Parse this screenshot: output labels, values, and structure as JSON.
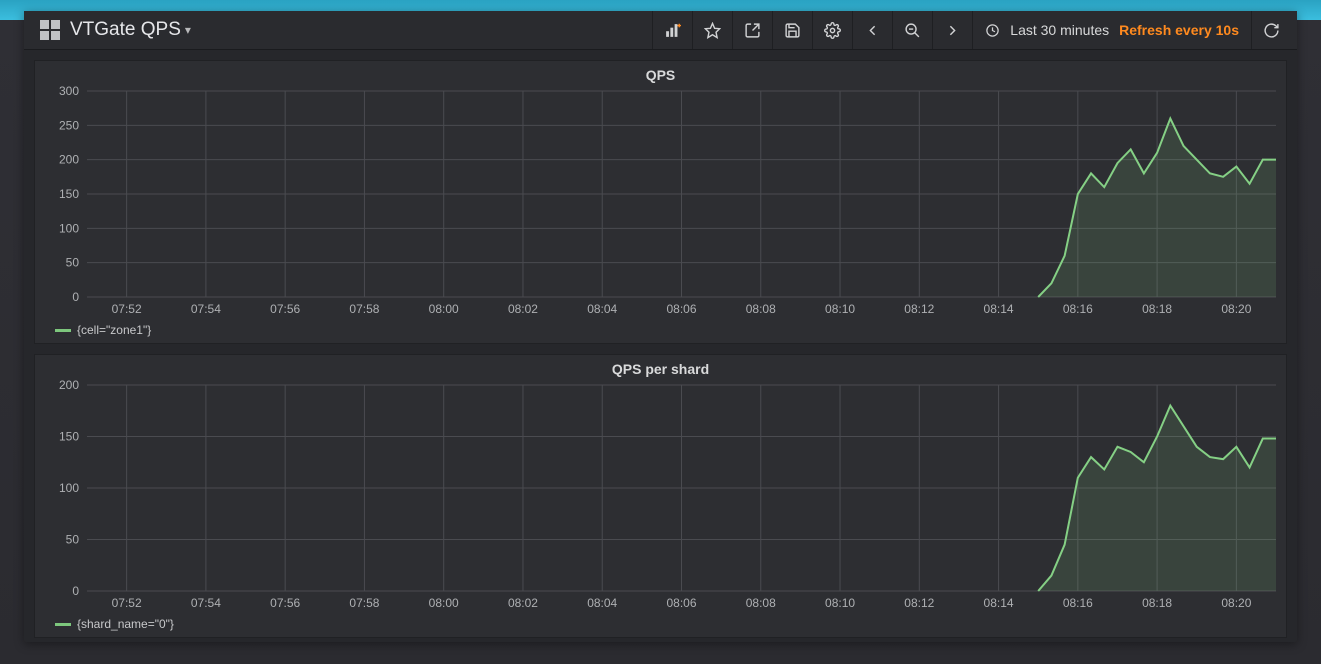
{
  "header": {
    "title": "VTGate QPS",
    "time_range": "Last 30 minutes",
    "refresh": "Refresh every 10s",
    "icons": {
      "add_panel": "add-panel-icon",
      "star": "star-icon",
      "share": "share-icon",
      "save": "save-icon",
      "settings": "gear-icon",
      "back": "chevron-left-icon",
      "zoom": "zoom-out-icon",
      "forward": "chevron-right-icon",
      "refresh_btn": "refresh-icon"
    }
  },
  "chart_data": [
    {
      "type": "area",
      "title": "QPS",
      "xlabel": "",
      "ylabel": "",
      "ylim": [
        0,
        300
      ],
      "xticks": [
        "07:52",
        "07:54",
        "07:56",
        "07:58",
        "08:00",
        "08:02",
        "08:04",
        "08:06",
        "08:08",
        "08:10",
        "08:12",
        "08:14",
        "08:16",
        "08:18",
        "08:20"
      ],
      "yticks": [
        0,
        50,
        100,
        150,
        200,
        250,
        300
      ],
      "series": [
        {
          "name": "{cell=\"zone1\"}",
          "color": "#85d085",
          "x": [
            "08:15:00",
            "08:15:20",
            "08:15:40",
            "08:16:00",
            "08:16:20",
            "08:16:40",
            "08:17:00",
            "08:17:20",
            "08:17:40",
            "08:18:00",
            "08:18:20",
            "08:18:40",
            "08:19:00",
            "08:19:20",
            "08:19:40",
            "08:20:00",
            "08:20:20",
            "08:20:40"
          ],
          "values": [
            0,
            20,
            60,
            150,
            180,
            160,
            195,
            215,
            180,
            210,
            260,
            220,
            200,
            180,
            175,
            190,
            165,
            200
          ]
        }
      ]
    },
    {
      "type": "area",
      "title": "QPS per shard",
      "xlabel": "",
      "ylabel": "",
      "ylim": [
        0,
        200
      ],
      "xticks": [
        "07:52",
        "07:54",
        "07:56",
        "07:58",
        "08:00",
        "08:02",
        "08:04",
        "08:06",
        "08:08",
        "08:10",
        "08:12",
        "08:14",
        "08:16",
        "08:18",
        "08:20"
      ],
      "yticks": [
        0,
        50,
        100,
        150,
        200
      ],
      "series": [
        {
          "name": "{shard_name=\"0\"}",
          "color": "#85d085",
          "x": [
            "08:15:00",
            "08:15:20",
            "08:15:40",
            "08:16:00",
            "08:16:20",
            "08:16:40",
            "08:17:00",
            "08:17:20",
            "08:17:40",
            "08:18:00",
            "08:18:20",
            "08:18:40",
            "08:19:00",
            "08:19:20",
            "08:19:40",
            "08:20:00",
            "08:20:20",
            "08:20:40"
          ],
          "values": [
            0,
            15,
            45,
            110,
            130,
            118,
            140,
            135,
            125,
            150,
            180,
            160,
            140,
            130,
            128,
            140,
            120,
            148
          ]
        }
      ]
    }
  ]
}
